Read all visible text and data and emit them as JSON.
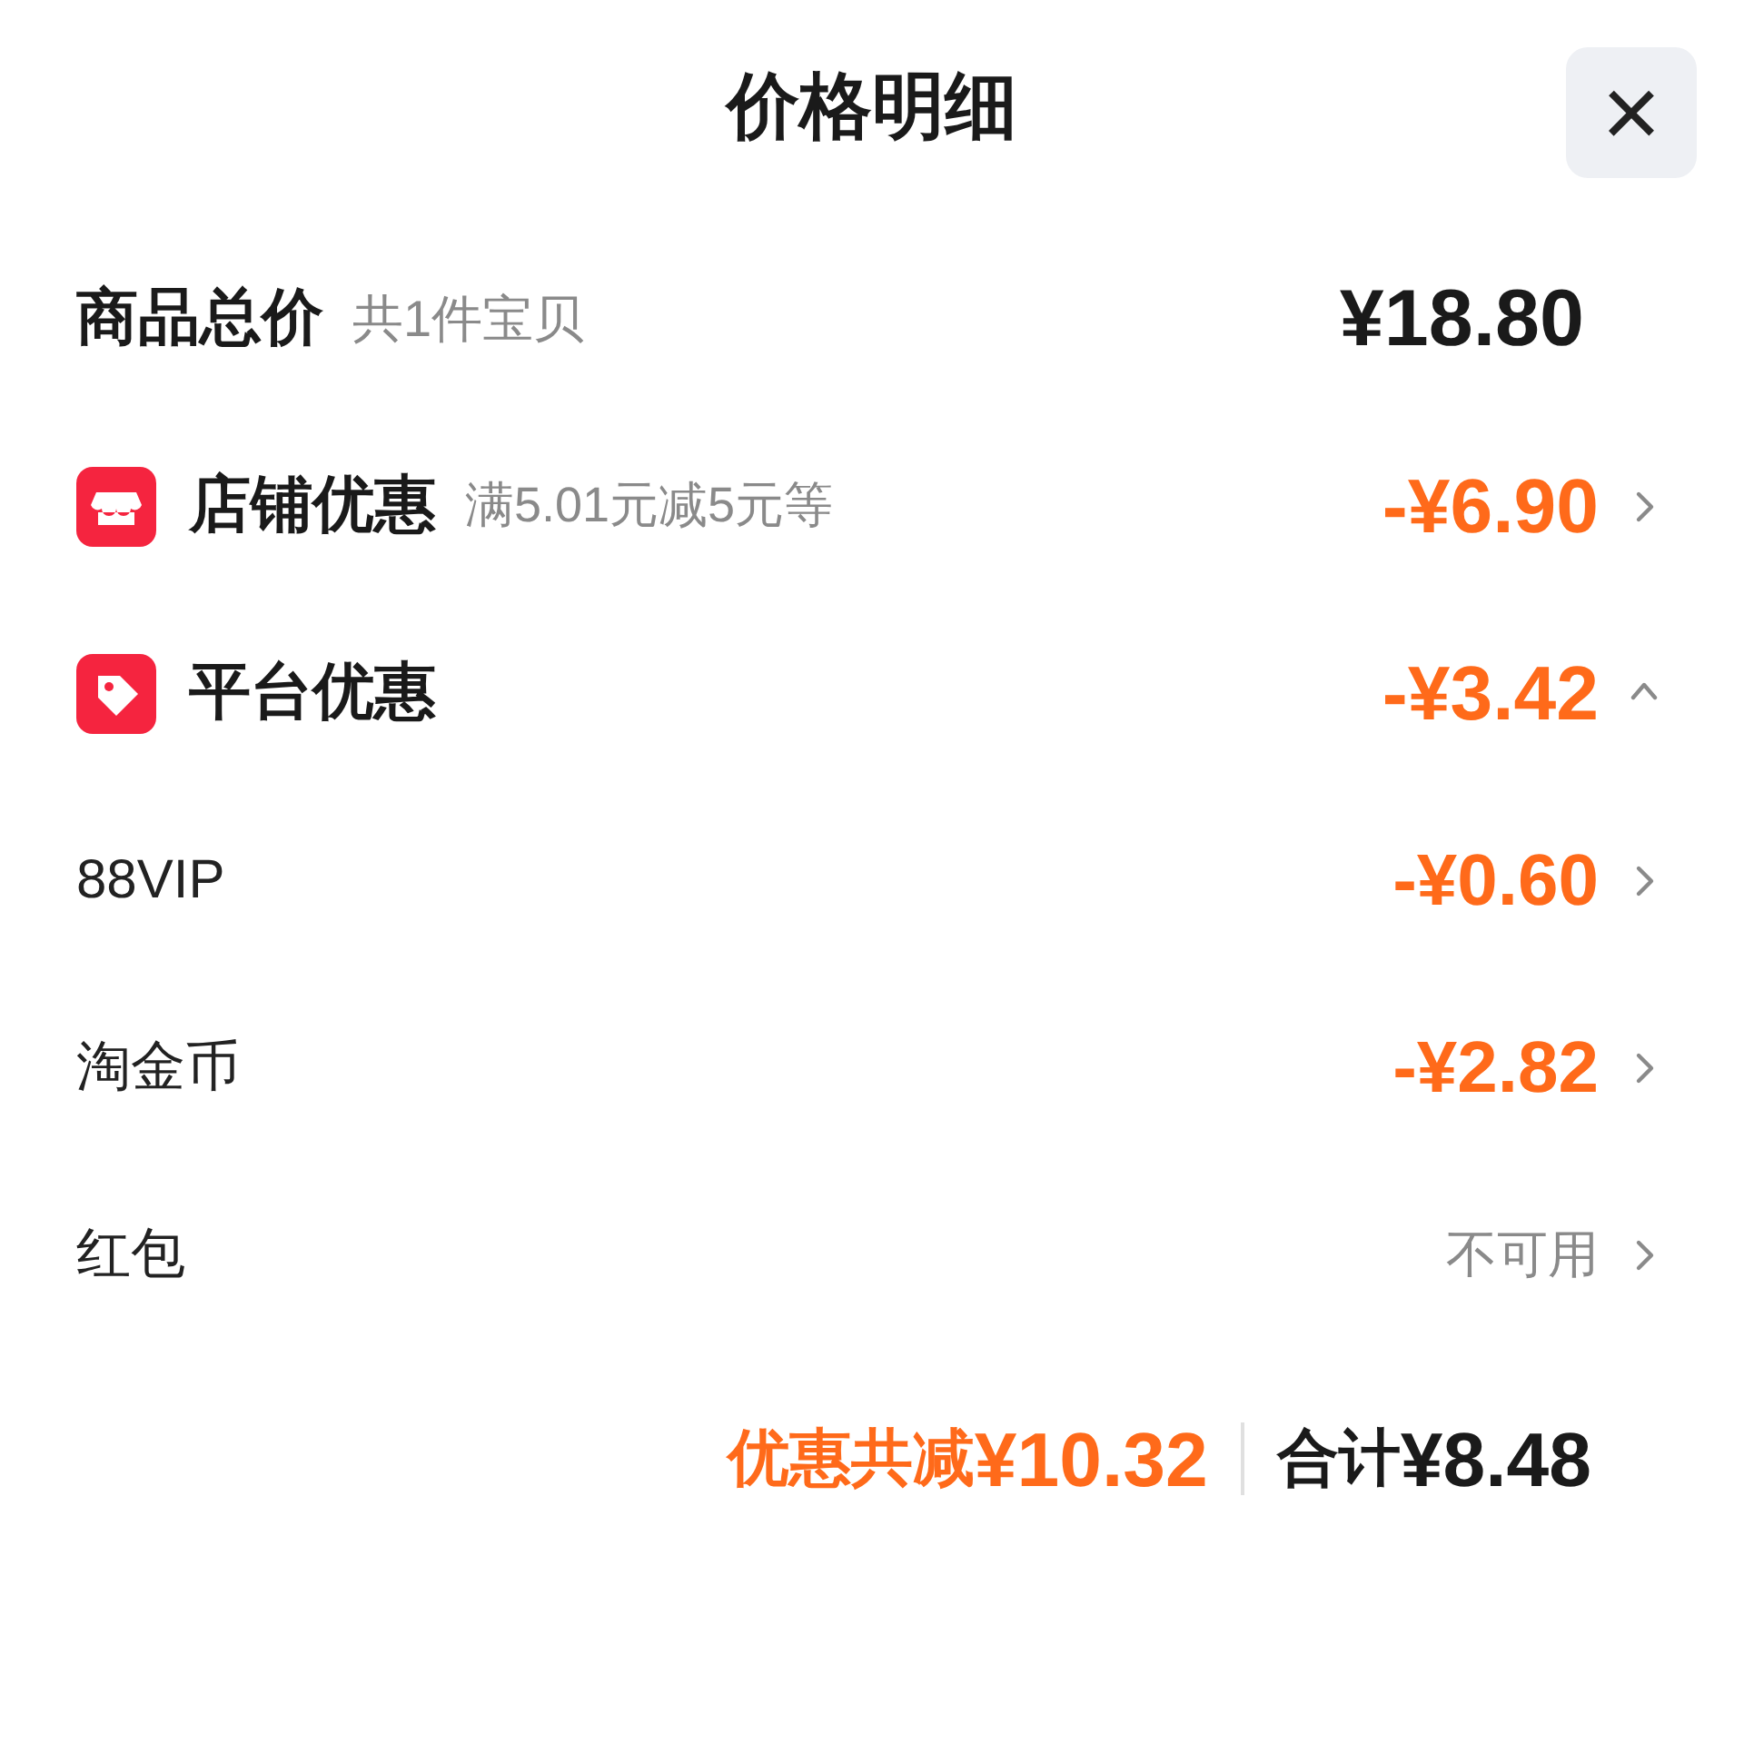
{
  "header": {
    "title": "价格明细",
    "close": "×"
  },
  "summary": {
    "label": "商品总价",
    "note": "共1件宝贝",
    "amount": "¥18.80"
  },
  "rows": [
    {
      "kind": "section",
      "label": "店铺优惠",
      "note": "满5.01元减5元等",
      "amount": "-¥6.90",
      "expanded": false
    },
    {
      "kind": "section",
      "label": "平台优惠",
      "amount": "-¥3.42",
      "expanded": true
    },
    {
      "kind": "item",
      "label": "88VIP",
      "amount": "-¥0.60",
      "available": true
    },
    {
      "kind": "item",
      "label": "淘金币",
      "amount": "-¥2.82",
      "available": true
    },
    {
      "kind": "item",
      "label": "红包",
      "amount": "不可用",
      "available": false
    }
  ],
  "footer": {
    "discount_label": "优惠共减",
    "discount_amount": "¥10.32",
    "total_label": "合计",
    "total_amount": "¥8.48"
  }
}
